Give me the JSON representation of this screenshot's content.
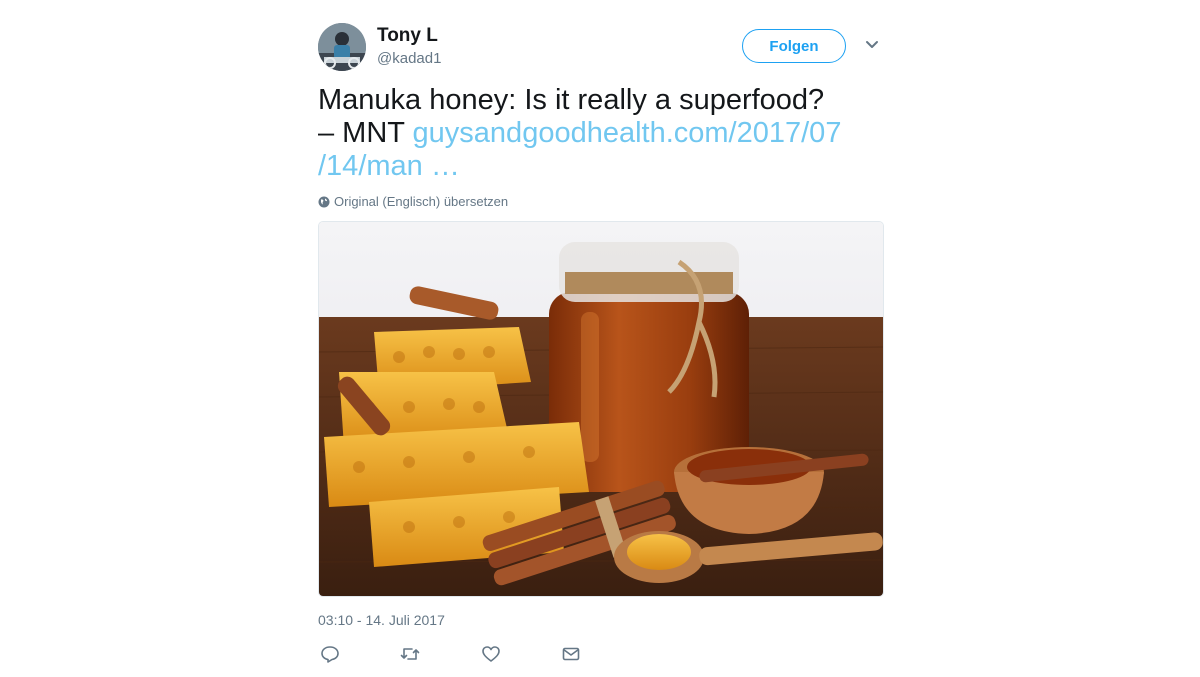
{
  "user": {
    "name": "Tony L",
    "handle": "@kadad1",
    "follow_label": "Folgen"
  },
  "tweet": {
    "text_line1": "Manuka honey: Is it really a superfood?",
    "text_line2_prefix": "– MNT ",
    "link_part1": "guysandgoodhealth.com/2017/07",
    "link_part2": "/14/man",
    "link_ellipsis": " …",
    "translate_label": "Original (Englisch) übersetzen",
    "timestamp": "03:10 - 14. Juli 2017"
  },
  "icons": {
    "caret": "chevron-down-icon",
    "globe": "globe-icon",
    "reply": "reply-icon",
    "retweet": "retweet-icon",
    "like": "heart-icon",
    "dm": "envelope-icon"
  },
  "colors": {
    "link": "#71c7f0",
    "follow": "#1da1f2",
    "muted": "#657786"
  }
}
